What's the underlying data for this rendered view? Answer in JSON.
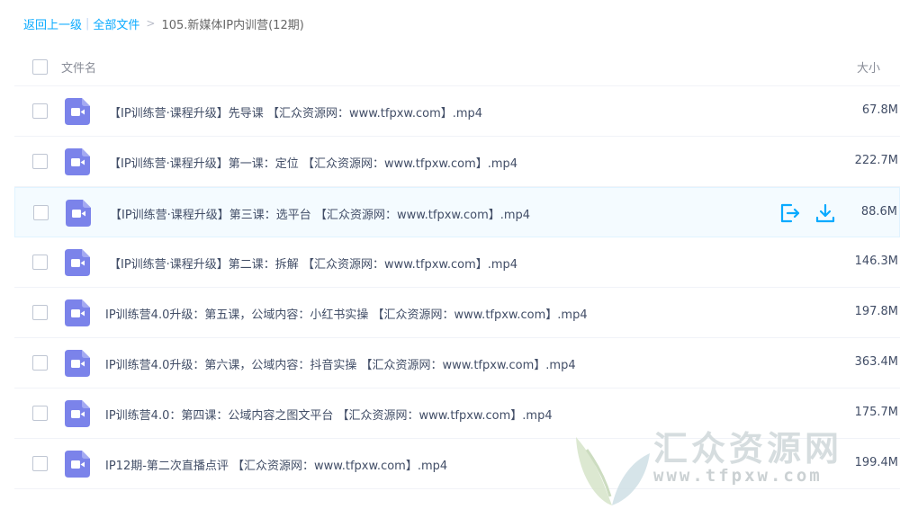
{
  "breadcrumb": {
    "back": "返回上一级",
    "separator": "|",
    "all_files": "全部文件",
    "arrow": ">",
    "current": "105.新媒体IP内训营(12期)"
  },
  "header": {
    "name": "文件名",
    "size": "大小"
  },
  "files": [
    {
      "name": "【IP训练营·课程升级】先导课 【汇众资源网：www.tfpxw.com】.mp4",
      "size": "67.8M"
    },
    {
      "name": "【IP训练营·课程升级】第一课：定位 【汇众资源网：www.tfpxw.com】.mp4",
      "size": "222.7M"
    },
    {
      "name": "【IP训练营·课程升级】第三课：选平台 【汇众资源网：www.tfpxw.com】.mp4",
      "size": "88.6M"
    },
    {
      "name": "【IP训练营·课程升级】第二课：拆解 【汇众资源网：www.tfpxw.com】.mp4",
      "size": "146.3M"
    },
    {
      "name": "IP训练营4.0升级：第五课，公域内容：小红书实操 【汇众资源网：www.tfpxw.com】.mp4",
      "size": "197.8M"
    },
    {
      "name": "IP训练营4.0升级：第六课，公域内容：抖音实操 【汇众资源网：www.tfpxw.com】.mp4",
      "size": "363.4M"
    },
    {
      "name": "IP训练营4.0：第四课：公域内容之图文平台 【汇众资源网：www.tfpxw.com】.mp4",
      "size": "175.7M"
    },
    {
      "name": "IP12期-第二次直播点评 【汇众资源网：www.tfpxw.com】.mp4",
      "size": "199.4M"
    }
  ],
  "hover_row_index": 2,
  "icons": {
    "file": "video-file-icon",
    "share": "share-icon",
    "download": "download-icon"
  },
  "colors": {
    "link": "#09aaff",
    "video_icon": "#7b83ea",
    "hover_bg": "#f4fbff",
    "action": "#09aaff"
  },
  "watermark": {
    "text": "汇众资源网",
    "url": "www.tfpxw.com"
  }
}
